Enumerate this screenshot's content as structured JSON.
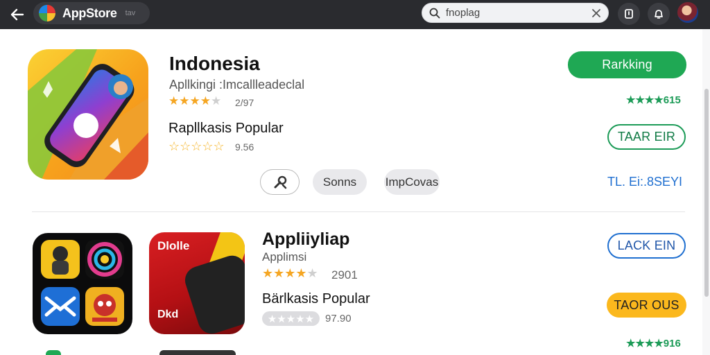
{
  "topbar": {
    "app_title": "AppStore",
    "app_sub": "tav",
    "search_value": "fnoplag"
  },
  "featured": {
    "name": "Indonesia",
    "subtitle": "Apllkingi :Imcallleadeclal",
    "stars": 4,
    "rating_text": "2/97",
    "popular_label": "Rapllkasis Popular",
    "stars2": 5,
    "rating2_text": "9.56",
    "chip_sonns": "Sonns",
    "chip_imp": "ImpCovas",
    "btn_ranking": "Rarkking",
    "green_rating": "★★★★615",
    "btn_install": "TAAR EIR",
    "blue_link": "TL. Ei:.8SEYI"
  },
  "second": {
    "name": "Appliiyliap",
    "subtitle": "Applimsi",
    "stars": 4,
    "rating_text": "2901",
    "popular_label": "Bärlkasis Popular",
    "rating2_text": "97.90",
    "btn_lack": "LACK EIN",
    "btn_taor": "TAOR OUS",
    "green_rating": "★★★★916",
    "red_icon_text": "Dlolle",
    "red_icon_text2": "Dkd"
  },
  "colors": {
    "topbar": "#2a2b2f",
    "green": "#1fa854",
    "blue": "#1f6fd0",
    "yellow": "#fbb81d",
    "star": "#f5a623"
  }
}
